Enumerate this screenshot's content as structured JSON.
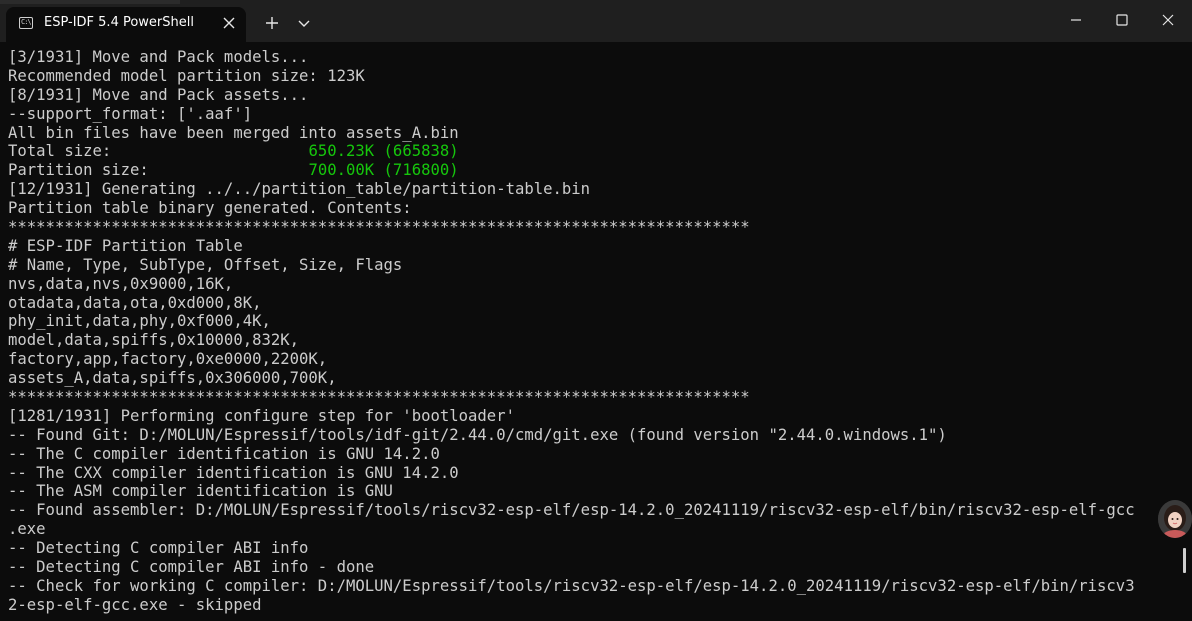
{
  "window": {
    "tab_title": "ESP-IDF 5.4 PowerShell",
    "tab_icon_glyph": "C:\\",
    "icons": {
      "tab": "terminal-icon",
      "tab_close": "close-icon",
      "new_tab": "plus-icon",
      "dropdown": "chevron-down-icon",
      "minimize": "minimize-icon",
      "maximize": "maximize-icon",
      "close": "close-icon"
    }
  },
  "colors": {
    "background": "#0c0c0c",
    "titlebar": "#1f1f1f",
    "text": "#cccccc",
    "green": "#16c60c"
  },
  "terminal": {
    "lines": [
      {
        "text": "[3/1931] Move and Pack models..."
      },
      {
        "text": "Recommended model partition size: 123K"
      },
      {
        "text": "[8/1931] Move and Pack assets..."
      },
      {
        "text": "--support_format: ['.aaf']"
      },
      {
        "text": "All bin files have been merged into assets_A.bin"
      },
      {
        "text": "Total size:                     ",
        "highlight": "650.23K (665838)"
      },
      {
        "text": "Partition size:                 ",
        "highlight": "700.00K (716800)"
      },
      {
        "text": "[12/1931] Generating ../../partition_table/partition-table.bin"
      },
      {
        "text": "Partition table binary generated. Contents:"
      },
      {
        "text": "*******************************************************************************"
      },
      {
        "text": "# ESP-IDF Partition Table"
      },
      {
        "text": "# Name, Type, SubType, Offset, Size, Flags"
      },
      {
        "text": "nvs,data,nvs,0x9000,16K,"
      },
      {
        "text": "otadata,data,ota,0xd000,8K,"
      },
      {
        "text": "phy_init,data,phy,0xf000,4K,"
      },
      {
        "text": "model,data,spiffs,0x10000,832K,"
      },
      {
        "text": "factory,app,factory,0xe0000,2200K,"
      },
      {
        "text": "assets_A,data,spiffs,0x306000,700K,"
      },
      {
        "text": "*******************************************************************************"
      },
      {
        "text": "[1281/1931] Performing configure step for 'bootloader'"
      },
      {
        "text": "-- Found Git: D:/MOLUN/Espressif/tools/idf-git/2.44.0/cmd/git.exe (found version \"2.44.0.windows.1\")"
      },
      {
        "text": "-- The C compiler identification is GNU 14.2.0"
      },
      {
        "text": "-- The CXX compiler identification is GNU 14.2.0"
      },
      {
        "text": "-- The ASM compiler identification is GNU"
      },
      {
        "text": "-- Found assembler: D:/MOLUN/Espressif/tools/riscv32-esp-elf/esp-14.2.0_20241119/riscv32-esp-elf/bin/riscv32-esp-elf-gcc"
      },
      {
        "text": ".exe"
      },
      {
        "text": "-- Detecting C compiler ABI info"
      },
      {
        "text": "-- Detecting C compiler ABI info - done"
      },
      {
        "text": "-- Check for working C compiler: D:/MOLUN/Espressif/tools/riscv32-esp-elf/esp-14.2.0_20241119/riscv32-esp-elf/bin/riscv3"
      },
      {
        "text": "2-esp-elf-gcc.exe - skipped"
      }
    ]
  }
}
